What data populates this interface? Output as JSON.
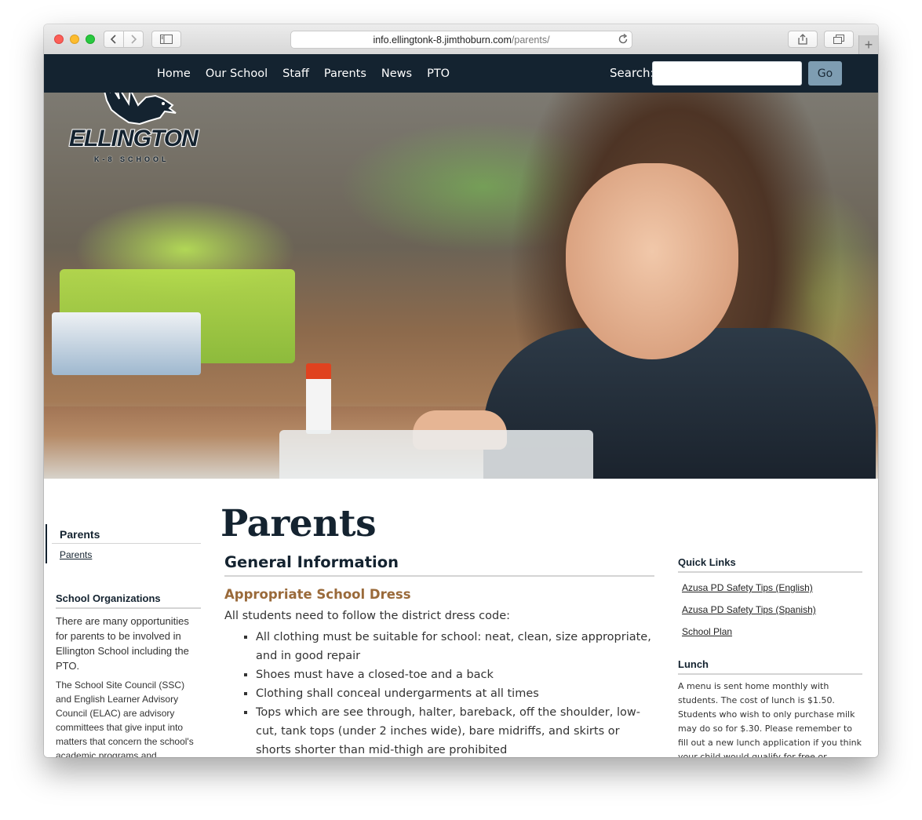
{
  "browser": {
    "url_host": "info.ellingtonk-8.jimthoburn.com",
    "url_path": "/parents/"
  },
  "nav": {
    "items": [
      "Home",
      "Our School",
      "Staff",
      "Parents",
      "News",
      "PTO"
    ],
    "search_label": "Search:",
    "search_value": "",
    "search_button": "Go"
  },
  "logo": {
    "name": "ELLINGTON",
    "subtitle": "K-8 SCHOOL"
  },
  "sidebar": {
    "section_title": "Parents",
    "links": [
      "Parents"
    ],
    "orgs_title": "School Organizations",
    "orgs_p1": "There are many opportunities for parents to be involved in Ellington School including the PTO.",
    "orgs_p2": "The School Site Council (SSC) and English Learner Advisory Council (ELAC) are advisory committees that give input into matters that concern the school's academic programs and"
  },
  "page": {
    "title": "Parents",
    "section_heading": "General Information",
    "subheading": "Appropriate School Dress",
    "intro": "All students need to follow the district dress code:",
    "dress_code": [
      "All clothing must be suitable for school: neat, clean, size appropriate, and in good repair",
      "Shoes must have a closed-toe and a back",
      "Clothing shall conceal undergarments at all times",
      "Tops which are see through, halter, bareback, off the shoulder, low-cut, tank tops (under 2 inches wide), bare midriffs, and skirts or shorts shorter than mid-thigh are prohibited"
    ]
  },
  "right_sidebar": {
    "quick_links_title": "Quick Links",
    "quick_links": [
      "Azusa PD Safety Tips (English)",
      "Azusa PD Safety Tips (Spanish)",
      "School Plan"
    ],
    "lunch_title": "Lunch",
    "lunch_text": "A menu is sent home monthly with students.  The cost of lunch is $1.50.  Students who wish to only purchase milk may do so for $.30.  Please remember to fill out a new lunch application if you think your child would qualify for free or reduced lunch.  The cost for"
  },
  "colors": {
    "nav_bg": "#142330",
    "accent_brown": "#9a6a3a",
    "go_button": "#7e9db2"
  }
}
